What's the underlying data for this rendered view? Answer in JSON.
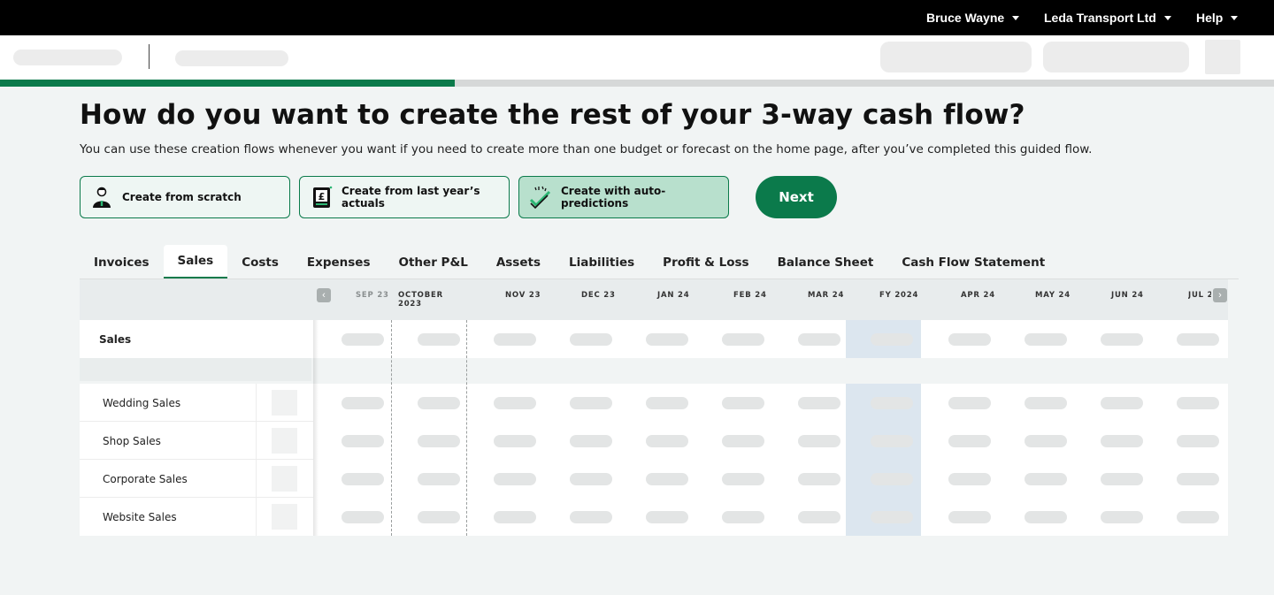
{
  "topbar": {
    "user": "Bruce Wayne",
    "company": "Leda Transport Ltd",
    "help": "Help"
  },
  "progress": {
    "fraction": 0.357
  },
  "page": {
    "title": "How do you want to create the rest of your 3-way cash flow?",
    "subtitle": "You can use these creation flows whenever you want if you need to create more than one budget or forecast on the home page, after you’ve completed this guided flow."
  },
  "options": [
    {
      "label": "Create from scratch",
      "icon": "person-icon",
      "selected": false
    },
    {
      "label": "Create from last year’s actuals",
      "icon": "ledger-book-icon",
      "selected": false
    },
    {
      "label": "Create with auto-predictions",
      "icon": "sparkle-check-icon",
      "selected": true
    }
  ],
  "next_label": "Next",
  "tabs": [
    "Invoices",
    "Sales",
    "Costs",
    "Expenses",
    "Other P&L",
    "Assets",
    "Liabilities",
    "Profit & Loss",
    "Balance Sheet",
    "Cash Flow Statement"
  ],
  "active_tab": "Sales",
  "columns": [
    "SEP 23",
    "OCTOBER 2023",
    "NOV 23",
    "DEC 23",
    "JAN 24",
    "FEB 24",
    "MAR 24",
    "FY 2024",
    "APR 24",
    "MAY 24",
    "JUN 24",
    "JUL 2"
  ],
  "section_label": "Sales",
  "rows": [
    "Wedding Sales",
    "Shop Sales",
    "Corporate Sales",
    "Website Sales"
  ],
  "colors": {
    "accent": "#0b7a4b",
    "selected_card": "#b8e0cd",
    "fy_column": "#dce6ef"
  }
}
